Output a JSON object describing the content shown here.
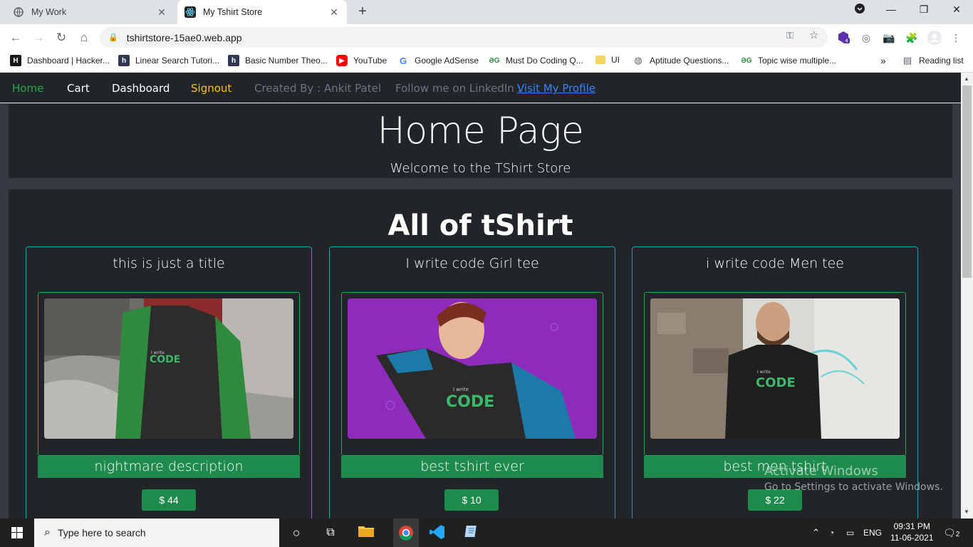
{
  "browser": {
    "tabs": [
      {
        "title": "My Work",
        "active": false
      },
      {
        "title": "My Tshirt Store",
        "active": true
      }
    ],
    "url": "tshirtstore-15ae0.web.app",
    "extension_badge": "4",
    "bookmarks": [
      {
        "label": "Dashboard | Hacker...",
        "icon": "hackerrank-icon"
      },
      {
        "label": "Linear Search Tutori...",
        "icon": "hackerearth-icon"
      },
      {
        "label": "Basic Number Theo...",
        "icon": "hackerearth-icon"
      },
      {
        "label": "YouTube",
        "icon": "youtube-icon"
      },
      {
        "label": "Google AdSense",
        "icon": "google-icon"
      },
      {
        "label": "Must Do Coding Q...",
        "icon": "gfg-icon"
      },
      {
        "label": "UI",
        "icon": "folder-icon"
      },
      {
        "label": "Aptitude Questions...",
        "icon": "globe-icon"
      },
      {
        "label": "Topic wise multiple...",
        "icon": "gfg-icon"
      }
    ],
    "more_bookmarks": "»",
    "reading_list": "Reading list"
  },
  "site": {
    "nav": {
      "home": "Home",
      "cart": "Cart",
      "dashboard": "Dashboard",
      "signout": "Signout",
      "created_by": "Created By : Ankit Patel",
      "follow": "Follow me on LinkedIn :",
      "profile_link": "Visit My Profile"
    },
    "jumbotron": {
      "title": "Home Page",
      "subtitle": "Welcome to the TShirt Store"
    },
    "section_heading": "All of tShirt",
    "products": [
      {
        "title": "this is just a title",
        "description": "nightmare description",
        "price": "$ 44"
      },
      {
        "title": "I write code Girl tee",
        "description": "best tshirt ever",
        "price": "$ 10"
      },
      {
        "title": "i write code Men tee",
        "description": "best men tshirt",
        "price": "$ 22"
      }
    ]
  },
  "watermark": {
    "line1": "Activate Windows",
    "line2": "Go to Settings to activate Windows."
  },
  "taskbar": {
    "search_placeholder": "Type here to search",
    "language": "ENG",
    "time": "09:31 PM",
    "date": "11-06-2021",
    "notification_count": "2"
  },
  "colors": {
    "nav_home": "#28a745",
    "nav_signout": "#ffc107",
    "card_border": "#17a2b8",
    "button_green": "#1e8a4c",
    "page_bg": "#343a40",
    "panel_bg": "#212529"
  }
}
